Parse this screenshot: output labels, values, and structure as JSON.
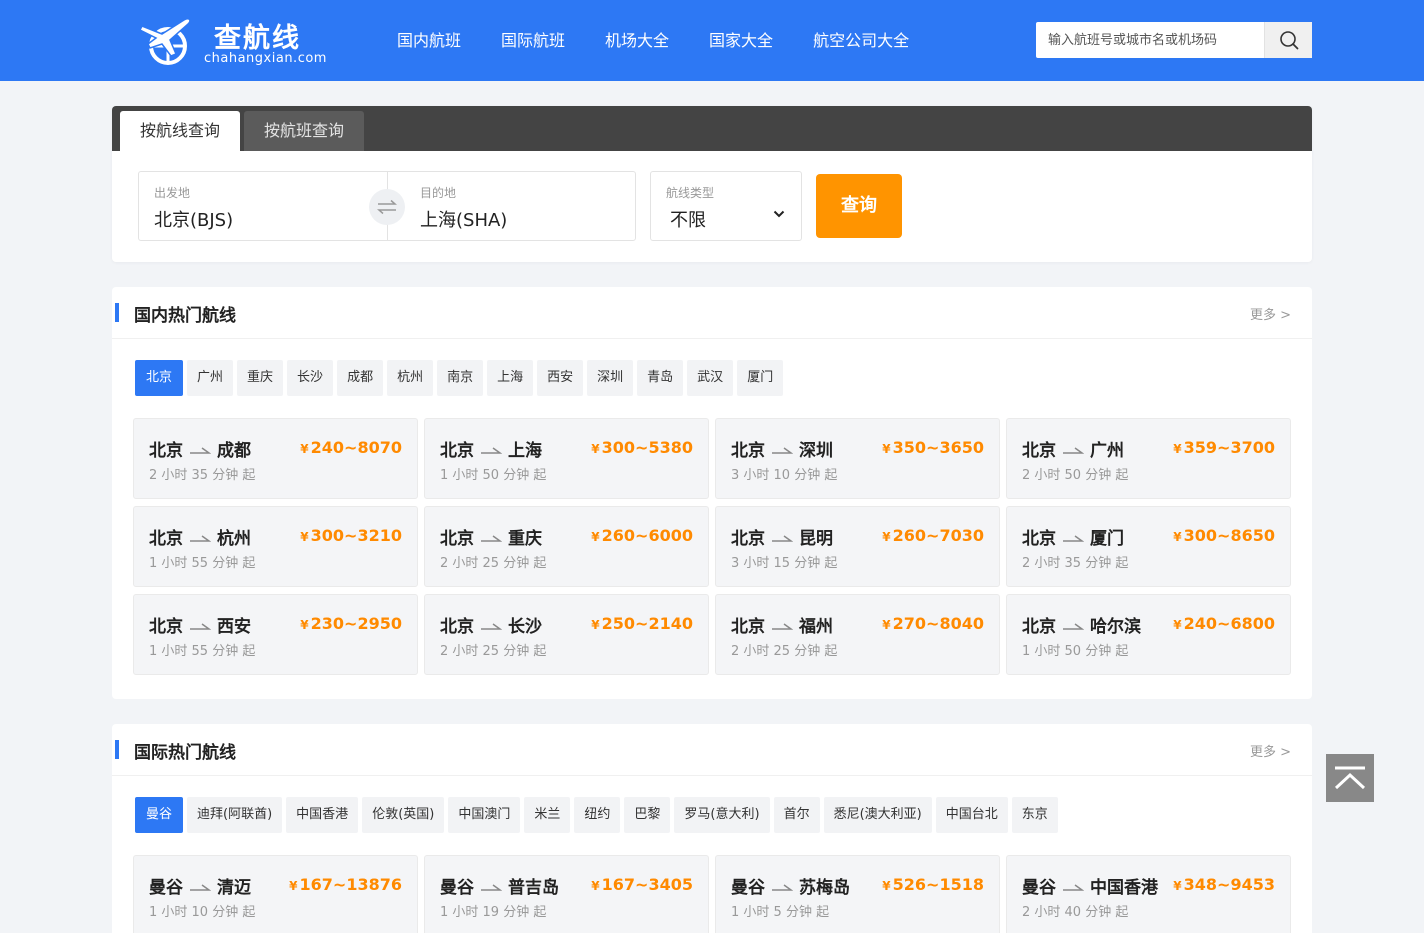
{
  "header": {
    "brand_name": "查航线",
    "brand_domain": "chahangxian.com",
    "nav": [
      "国内航班",
      "国际航班",
      "机场大全",
      "国家大全",
      "航空公司大全"
    ],
    "search_placeholder": "输入航班号或城市名或机场码"
  },
  "search_panel": {
    "tabs": [
      "按航线查询",
      "按航班查询"
    ],
    "origin_label": "出发地",
    "origin_value": "北京(BJS)",
    "dest_label": "目的地",
    "dest_value": "上海(SHA)",
    "type_label": "航线类型",
    "type_value": "不限",
    "query_label": "查询"
  },
  "domestic": {
    "title": "国内热门航线",
    "more": "更多 >",
    "cities": [
      "北京",
      "广州",
      "重庆",
      "长沙",
      "成都",
      "杭州",
      "南京",
      "上海",
      "西安",
      "深圳",
      "青岛",
      "武汉",
      "厦门"
    ],
    "routes": [
      {
        "from": "北京",
        "to": "成都",
        "price": "240~8070",
        "time": "2 小时 35 分钟 起"
      },
      {
        "from": "北京",
        "to": "上海",
        "price": "300~5380",
        "time": "1 小时 50 分钟 起"
      },
      {
        "from": "北京",
        "to": "深圳",
        "price": "350~3650",
        "time": "3 小时 10 分钟 起"
      },
      {
        "from": "北京",
        "to": "广州",
        "price": "359~3700",
        "time": "2 小时 50 分钟 起"
      },
      {
        "from": "北京",
        "to": "杭州",
        "price": "300~3210",
        "time": "1 小时 55 分钟 起"
      },
      {
        "from": "北京",
        "to": "重庆",
        "price": "260~6000",
        "time": "2 小时 25 分钟 起"
      },
      {
        "from": "北京",
        "to": "昆明",
        "price": "260~7030",
        "time": "3 小时 15 分钟 起"
      },
      {
        "from": "北京",
        "to": "厦门",
        "price": "300~8650",
        "time": "2 小时 35 分钟 起"
      },
      {
        "from": "北京",
        "to": "西安",
        "price": "230~2950",
        "time": "1 小时 55 分钟 起"
      },
      {
        "from": "北京",
        "to": "长沙",
        "price": "250~2140",
        "time": "2 小时 25 分钟 起"
      },
      {
        "from": "北京",
        "to": "福州",
        "price": "270~8040",
        "time": "2 小时 25 分钟 起"
      },
      {
        "from": "北京",
        "to": "哈尔滨",
        "price": "240~6800",
        "time": "1 小时 50 分钟 起"
      }
    ]
  },
  "international": {
    "title": "国际热门航线",
    "more": "更多 >",
    "cities": [
      "曼谷",
      "迪拜(阿联酋)",
      "中国香港",
      "伦敦(英国)",
      "中国澳门",
      "米兰",
      "纽约",
      "巴黎",
      "罗马(意大利)",
      "首尔",
      "悉尼(澳大利亚)",
      "中国台北",
      "东京"
    ],
    "routes": [
      {
        "from": "曼谷",
        "to": "清迈",
        "price": "167~13876",
        "time": "1 小时 10 分钟 起"
      },
      {
        "from": "曼谷",
        "to": "普吉岛",
        "price": "167~3405",
        "time": "1 小时 19 分钟 起"
      },
      {
        "from": "曼谷",
        "to": "苏梅岛",
        "price": "526~1518",
        "time": "1 小时 5 分钟 起"
      },
      {
        "from": "曼谷",
        "to": "中国香港",
        "price": "348~9453",
        "time": "2 小时 40 分钟 起"
      }
    ]
  },
  "currency_symbol": "¥",
  "colors": {
    "brand": "#2d78f4",
    "accent": "#ff9400",
    "price": "#ff8a00"
  }
}
